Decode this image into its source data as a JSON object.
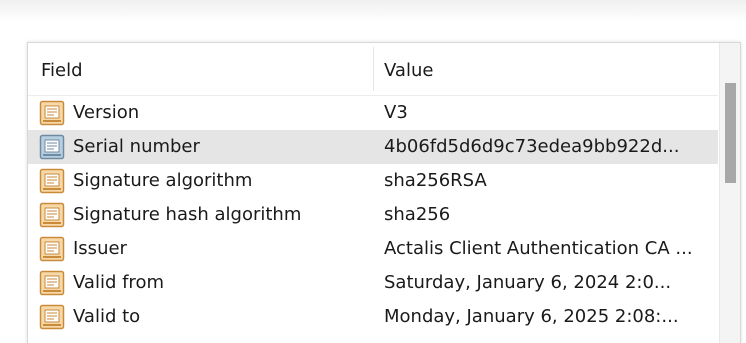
{
  "columns": {
    "field": "Field",
    "value": "Value"
  },
  "rows": [
    {
      "field": "Version",
      "value": "V3",
      "icon": "certificate-field-icon",
      "selected": false
    },
    {
      "field": "Serial number",
      "value": "4b06fd5d6d9c73edea9bb922d...",
      "icon": "certificate-field-icon-selected",
      "selected": true
    },
    {
      "field": "Signature algorithm",
      "value": "sha256RSA",
      "icon": "certificate-field-icon",
      "selected": false
    },
    {
      "field": "Signature hash algorithm",
      "value": "sha256",
      "icon": "certificate-field-icon",
      "selected": false
    },
    {
      "field": "Issuer",
      "value": "Actalis Client Authentication CA ...",
      "icon": "certificate-field-icon",
      "selected": false
    },
    {
      "field": "Valid from",
      "value": "Saturday, January 6, 2024 2:0...",
      "icon": "certificate-field-icon",
      "selected": false
    },
    {
      "field": "Valid to",
      "value": "Monday, January 6, 2025 2:08:...",
      "icon": "certificate-field-icon",
      "selected": false
    }
  ],
  "colors": {
    "icon_fill": "#f6d9a8",
    "icon_stroke": "#c98a3a",
    "icon_selected_fill": "#b8cfe0",
    "icon_selected_stroke": "#6f8aa3",
    "selected_row_bg": "#e5e5e5"
  }
}
